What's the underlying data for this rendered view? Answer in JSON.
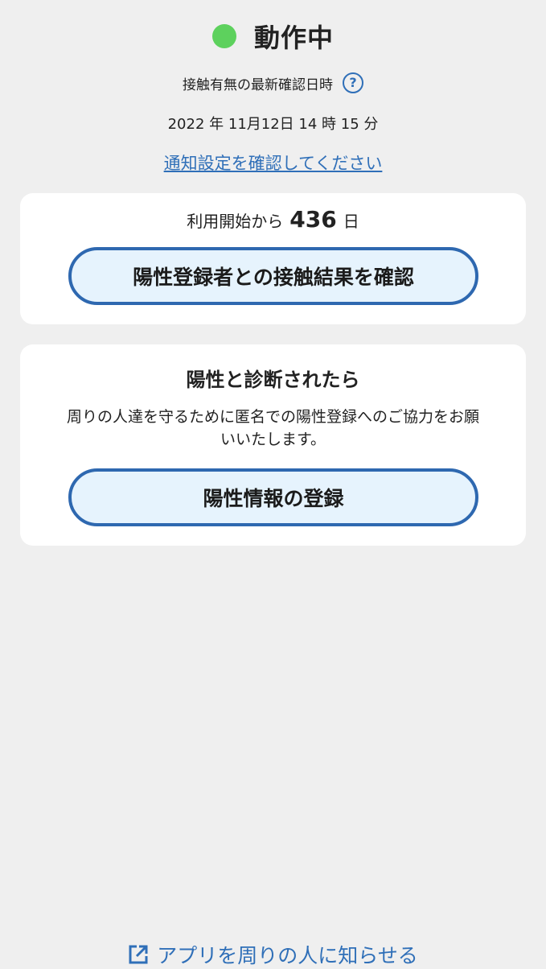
{
  "status": {
    "label": "動作中",
    "dot_color": "#5dd15d"
  },
  "contact_check": {
    "label": "接触有無の最新確認日時",
    "help_icon": "question-circle-icon",
    "help_glyph": "?",
    "timestamp": "2022 年 11月12日 14 時 15 分"
  },
  "notification_link": "通知設定を確認してください",
  "usage_card": {
    "prefix": "利用開始から",
    "days": "436",
    "suffix": "日",
    "button_label": "陽性登録者との接触結果を確認"
  },
  "positive_card": {
    "title": "陽性と診断されたら",
    "description": "周りの人達を守るために匿名での陽性登録へのご協力をお願いいたします。",
    "button_label": "陽性情報の登録"
  },
  "share_link": {
    "icon": "external-link-icon",
    "label": "アプリを周りの人に知らせる"
  },
  "colors": {
    "accent": "#2f6fb8",
    "button_fill": "#e6f3fd",
    "background": "#efefef"
  }
}
